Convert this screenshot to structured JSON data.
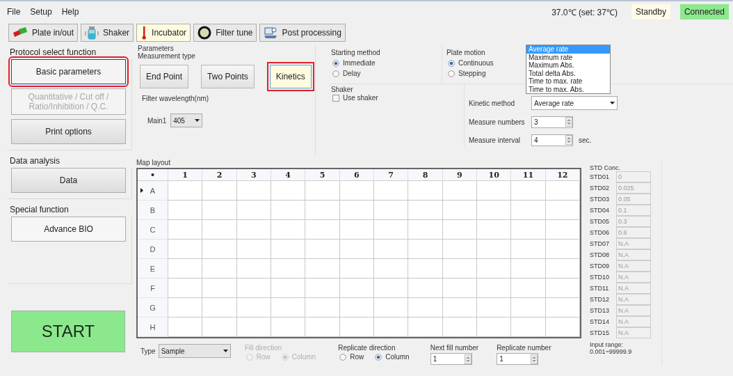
{
  "menu": [
    "File",
    "Setup",
    "Help"
  ],
  "status": {
    "temperature": "37.0℃ (set: 37℃)",
    "state": "Standby",
    "connection": "Connected"
  },
  "toolbar": [
    {
      "label": "Plate in/out",
      "kind": "plate",
      "selected": false
    },
    {
      "label": "Shaker",
      "kind": "shaker",
      "selected": false
    },
    {
      "label": "Incubator",
      "kind": "incubator",
      "selected": true
    },
    {
      "label": "Filter tune",
      "kind": "filter",
      "selected": false
    },
    {
      "label": "Post processing",
      "kind": "post",
      "selected": false
    }
  ],
  "protocol": {
    "title": "Protocol select function",
    "buttons": [
      {
        "label": "Basic parameters",
        "selected": true,
        "highlighted": true,
        "disabled": false
      },
      {
        "label": "Quantitative / Cut off /\nRatio/Inhibition / Q.C.",
        "selected": false,
        "highlighted": false,
        "disabled": true
      },
      {
        "label": "Print options",
        "selected": false,
        "highlighted": false,
        "disabled": false
      }
    ]
  },
  "data_analysis": {
    "title": "Data analysis",
    "button": "Data"
  },
  "special_function": {
    "title": "Special function",
    "button": "Advance BIO"
  },
  "start": "START",
  "parameters": {
    "title": "Parameters",
    "measurement_type": {
      "title": "Measurement type",
      "options": [
        {
          "label": "End Point",
          "selected": false,
          "highlighted": false
        },
        {
          "label": "Two Points",
          "selected": false,
          "highlighted": false
        },
        {
          "label": "Kinetics",
          "selected": true,
          "highlighted": true
        }
      ]
    },
    "filter": {
      "title": "Filter wavelength(nm)",
      "label": "Main1",
      "value": "405"
    },
    "starting_method": {
      "title": "Starting method",
      "options": [
        {
          "label": "Immediate",
          "selected": true
        },
        {
          "label": "Delay",
          "selected": false
        }
      ]
    },
    "plate_motion": {
      "title": "Plate motion",
      "options": [
        {
          "label": "Continuous",
          "selected": true
        },
        {
          "label": "Stepping",
          "selected": false
        }
      ]
    },
    "shaker": {
      "title": "Shaker",
      "label": "Use shaker",
      "checked": false
    },
    "kinetic": {
      "method_label": "Kinetic method",
      "method_value": "Average rate",
      "dropdown": [
        {
          "label": "Average rate",
          "selected": true
        },
        {
          "label": "Maximum rate",
          "selected": false
        },
        {
          "label": "Maximum Abs.",
          "selected": false
        },
        {
          "label": "Total delta Abs.",
          "selected": false
        },
        {
          "label": "Time to max. rate",
          "selected": false
        },
        {
          "label": "Time to max. Abs.",
          "selected": false
        }
      ],
      "numbers_label": "Measure numbers",
      "numbers_value": "3",
      "interval_label": "Measure interval",
      "interval_value": "4",
      "unit": "sec."
    }
  },
  "map": {
    "title": "Map layout",
    "corner": "•",
    "columns": [
      "1",
      "2",
      "3",
      "4",
      "5",
      "6",
      "7",
      "8",
      "9",
      "10",
      "11",
      "12"
    ],
    "rows": [
      {
        "label": "A",
        "current": true
      },
      {
        "label": "B",
        "current": false
      },
      {
        "label": "C",
        "current": false
      },
      {
        "label": "D",
        "current": false
      },
      {
        "label": "E",
        "current": false
      },
      {
        "label": "F",
        "current": false
      },
      {
        "label": "G",
        "current": false
      },
      {
        "label": "H",
        "current": false
      }
    ]
  },
  "bottom": {
    "type_label": "Type",
    "type_value": "Sample",
    "fill": {
      "title": "Fill direction",
      "disabled": true,
      "options": [
        {
          "label": "Row",
          "selected": false
        },
        {
          "label": "Column",
          "selected": true
        }
      ]
    },
    "replicate": {
      "title": "Replicate direction",
      "disabled": false,
      "options": [
        {
          "label": "Row",
          "selected": false
        },
        {
          "label": "Column",
          "selected": true
        }
      ]
    },
    "next_fill": {
      "label": "Next fill number",
      "value": "1"
    },
    "replicate_number": {
      "label": "Replicate number",
      "value": "1"
    }
  },
  "std": {
    "title": "STD Conc.",
    "items": [
      {
        "label": "STD01",
        "value": "0"
      },
      {
        "label": "STD02",
        "value": "0.025"
      },
      {
        "label": "STD03",
        "value": "0.05"
      },
      {
        "label": "STD04",
        "value": "0.1"
      },
      {
        "label": "STD05",
        "value": "0.3"
      },
      {
        "label": "STD06",
        "value": "0.6"
      },
      {
        "label": "STD07",
        "value": "N.A"
      },
      {
        "label": "STD08",
        "value": "N.A"
      },
      {
        "label": "STD09",
        "value": "N.A"
      },
      {
        "label": "STD10",
        "value": "N.A"
      },
      {
        "label": "STD11",
        "value": "N.A"
      },
      {
        "label": "STD12",
        "value": "N.A"
      },
      {
        "label": "STD13",
        "value": "N.A"
      },
      {
        "label": "STD14",
        "value": "N.A"
      },
      {
        "label": "STD15",
        "value": "N.A"
      }
    ],
    "range_label": "Input range:",
    "range": "0.001~99999.9"
  }
}
